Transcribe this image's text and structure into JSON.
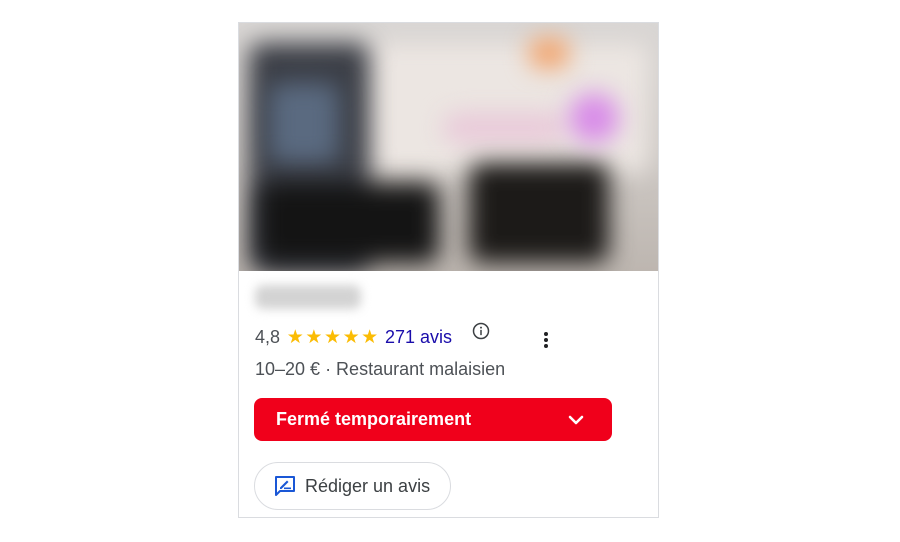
{
  "place": {
    "rating": "4,8",
    "star_count": 5,
    "reviews_link": "271 avis",
    "price_category": "10–20 € · Restaurant malaisien",
    "status": "Fermé temporairement",
    "write_review": "Rédiger un avis"
  },
  "icons": {
    "star": "★",
    "info": "info-icon",
    "more": "more-vert-icon",
    "chevron": "chevron-down-icon",
    "review": "rate-review-icon"
  },
  "colors": {
    "status_background": "#f0001b",
    "link": "#1a0dab",
    "star": "#fbbc04",
    "review_icon": "#1a57d6"
  }
}
